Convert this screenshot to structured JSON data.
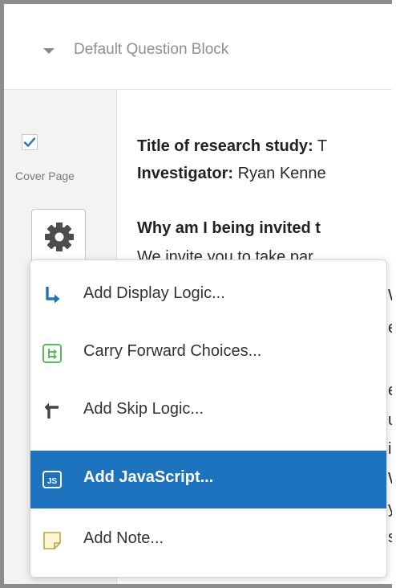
{
  "block": {
    "title": "Default Question Block"
  },
  "sidebar": {
    "cover_label": "Cover Page",
    "cover_checked": true
  },
  "content": {
    "title_label": "Title of research study:",
    "title_value": " T",
    "investigator_label": "Investigator:",
    "investigator_value": " Ryan Kenne",
    "why_heading": "Why am I being invited t",
    "fragments": [
      "We invite you to take par",
      "W",
      "e",
      "ei",
      "u",
      "ir",
      "W",
      "y",
      "s c"
    ]
  },
  "menu": {
    "items": [
      {
        "label": "Add Display Logic...",
        "icon": "display-logic-icon"
      },
      {
        "label": "Carry Forward Choices...",
        "icon": "carry-forward-icon"
      },
      {
        "label": "Add Skip Logic...",
        "icon": "skip-logic-icon"
      },
      {
        "label": "Add JavaScript...",
        "icon": "javascript-icon",
        "active": true
      },
      {
        "label": "Add Note...",
        "icon": "note-icon"
      }
    ]
  },
  "colors": {
    "accent": "#1e73be",
    "check": "#1e73be",
    "carry_forward_icon": "#5cb85c",
    "note_icon_fill": "#fdf6d3",
    "note_icon_stroke": "#b9a54a"
  }
}
